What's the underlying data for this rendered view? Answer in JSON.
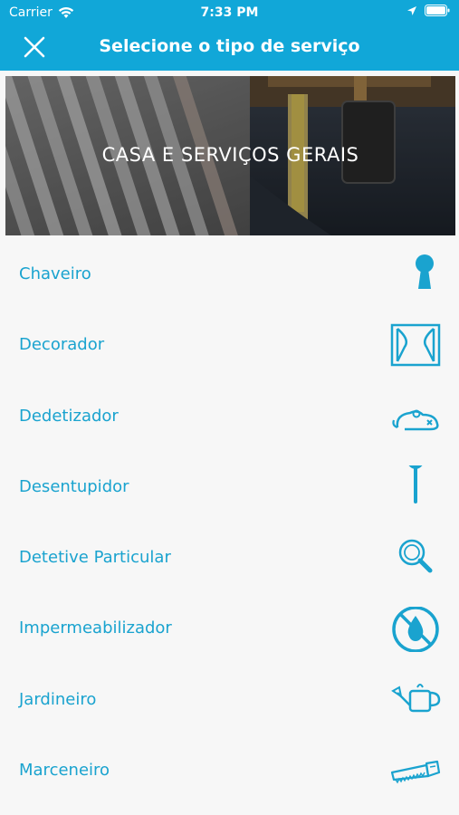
{
  "status_bar": {
    "carrier": "Carrier",
    "time": "7:33 PM"
  },
  "nav": {
    "title": "Selecione o tipo de serviço",
    "close_icon": "close-icon"
  },
  "banner": {
    "title": "CASA E SERVIÇOS GERAIS"
  },
  "services": [
    {
      "label": "Chaveiro",
      "icon": "keyhole-icon"
    },
    {
      "label": "Decorador",
      "icon": "curtain-window-icon"
    },
    {
      "label": "Dedetizador",
      "icon": "mouse-icon"
    },
    {
      "label": "Desentupidor",
      "icon": "plunger-icon"
    },
    {
      "label": "Detetive Particular",
      "icon": "magnifier-icon"
    },
    {
      "label": "Impermeabilizador",
      "icon": "no-water-icon"
    },
    {
      "label": "Jardineiro",
      "icon": "watering-can-icon"
    },
    {
      "label": "Marceneiro",
      "icon": "saw-icon"
    }
  ],
  "colors": {
    "accent": "#11a7d8",
    "text": "#1aa3cf",
    "background": "#f7f7f7"
  }
}
